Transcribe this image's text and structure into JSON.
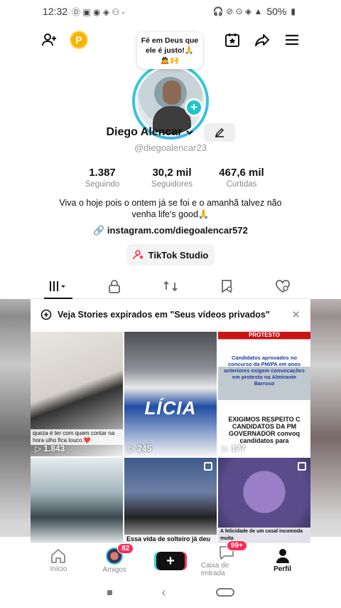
{
  "status_bar": {
    "time": "12:32",
    "battery": "50%"
  },
  "bubble": {
    "line1": "Fé em Deus que",
    "line2": "ele é justo!🙏",
    "line3": "🙇🙌"
  },
  "profile": {
    "name": "Diego Alencar",
    "handle": "@diegoalencar23",
    "bio_line1": "Viva o hoje pois o ontem já se foi e o amanhã talvez não",
    "bio_line2": "venha life's good🙏",
    "link": "instagram.com/diegoalencar572",
    "studio_button": "TikTok Studio",
    "coin_letter": "P"
  },
  "stats": [
    {
      "value": "1.387",
      "label": "Seguindo"
    },
    {
      "value": "30,2 mil",
      "label": "Seguidores"
    },
    {
      "value": "467,6 mil",
      "label": "Curtidas"
    }
  ],
  "stories_banner": {
    "text": "Veja Stories expirados em \"Seus vídeos privados\""
  },
  "videos": [
    {
      "views": "1.843",
      "caption": "queza é ter com quem contar na hora  ulho fica louco.❤️"
    },
    {
      "views": "245",
      "caption": "LÍCIA"
    },
    {
      "views": "177",
      "title": "PROTESTO",
      "caption": "Candidatos aprovados no concurso da PM/PA em anos anteriores exigem convocações em protesto na Almirante Barroso",
      "caption2": "EXIGIMOS RESPEITO C CANDIDATOS DA PM GOVERNADOR convoq candidatos para"
    },
    {
      "views": "",
      "caption": ""
    },
    {
      "views": "",
      "caption": "Essa vida de solteiro já deu"
    },
    {
      "views": "",
      "caption": "A felicidade de um casal incomoda muita"
    }
  ],
  "nav": {
    "home": "Início",
    "friends": "Amigos",
    "friends_badge": "82",
    "inbox": "Caixa de entrada",
    "inbox_badge": "99+",
    "profile": "Perfil",
    "create": "+"
  },
  "colors": {
    "accent_cyan": "#20c5c9",
    "badge_red": "#fe2c55",
    "coin": "#f7b500"
  }
}
